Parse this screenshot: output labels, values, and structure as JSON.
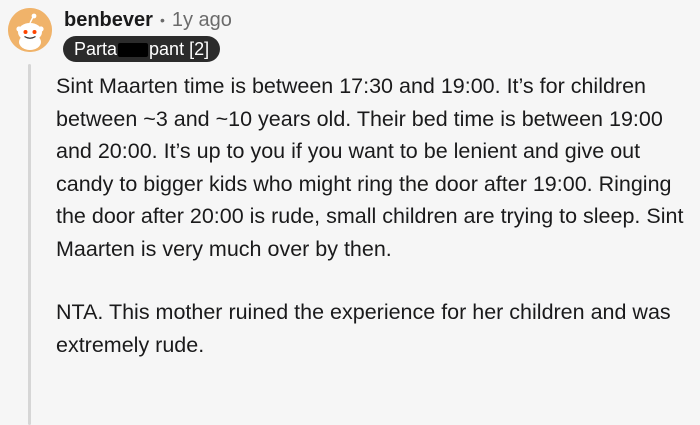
{
  "comment": {
    "username": "benbever",
    "separator": "•",
    "age": "1y ago",
    "flair": {
      "before_redaction": "Parta",
      "after_redaction": "pant [2]"
    },
    "paragraphs": [
      "Sint Maarten time is between 17:30 and 19:00. It’s for children between ~3 and ~10 years old. Their bed time is between 19:00 and 20:00. It’s up to you if you want to be lenient and give out candy to bigger kids who might ring the door after 19:00. Ringing the door after 20:00 is rude, small children are trying to sleep. Sint Maarten is very much over by then.",
      "NTA. This mother ruined the experience for her children and was extremely rude."
    ]
  },
  "icons": {
    "avatar": "reddit-snoo-avatar-icon"
  },
  "colors": {
    "background": "#f6f6f6",
    "text": "#1a1a1b",
    "muted": "#6b6b6b",
    "flair_bg": "#2b2b2b",
    "avatar_bg": "#f0b36a",
    "thread_line": "#d6d6d6"
  }
}
